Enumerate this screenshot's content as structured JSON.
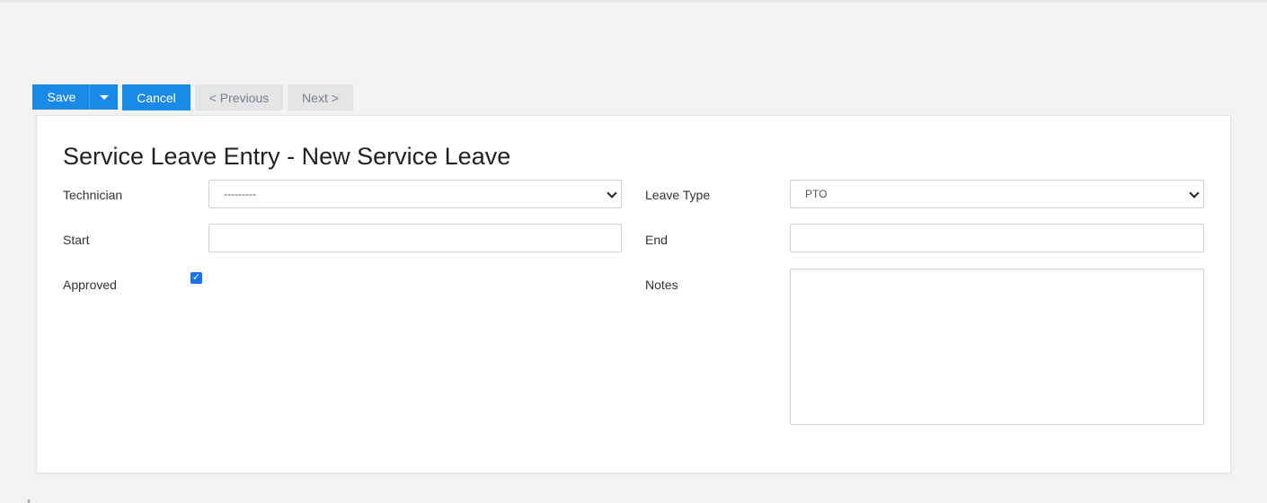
{
  "toolbar": {
    "save_label": "Save",
    "cancel_label": "Cancel",
    "previous_label": "< Previous",
    "next_label": "Next >"
  },
  "form": {
    "title": "Service Leave Entry - New Service Leave",
    "technician": {
      "label": "Technician",
      "selected": "---------"
    },
    "leave_type": {
      "label": "Leave Type",
      "selected": "PTO"
    },
    "start": {
      "label": "Start",
      "value": ""
    },
    "end": {
      "label": "End",
      "value": ""
    },
    "approved": {
      "label": "Approved",
      "checked": true
    },
    "notes": {
      "label": "Notes",
      "value": ""
    }
  },
  "icons": {
    "save_menu": "chevron-down-icon",
    "select_arrow": "chevron-down-icon",
    "checkbox": "check-icon"
  },
  "colors": {
    "primary": "#1a8ae8",
    "disabled_bg": "#e3e5e7",
    "page_bg": "#f3f3f3"
  }
}
